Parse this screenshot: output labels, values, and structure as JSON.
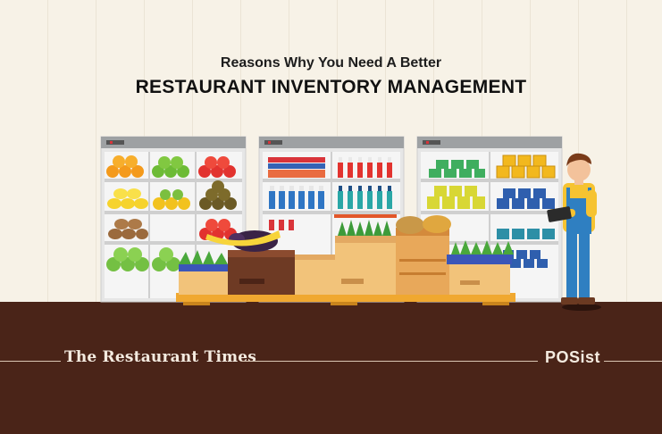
{
  "header": {
    "subtitle": "Reasons Why You Need A Better",
    "title": "RESTAURANT INVENTORY MANAGEMENT"
  },
  "footer": {
    "publication": "The Restaurant Times",
    "partner_logo": "POSist"
  },
  "colors": {
    "background": "#f7f2e7",
    "floor": "#4a2418",
    "shelf_frame": "#e4e4e4",
    "shelf_header": "#9ea1a3",
    "crate": "#f2c37a",
    "pallet": "#f0a830",
    "worker_overalls": "#2f7fc1",
    "worker_shirt": "#f6c331"
  },
  "icons": [
    "fruit-shelf-icon",
    "bottle-shelf-icon",
    "canned-goods-shelf-icon",
    "produce-crates-icon",
    "worker-with-tablet-icon"
  ]
}
